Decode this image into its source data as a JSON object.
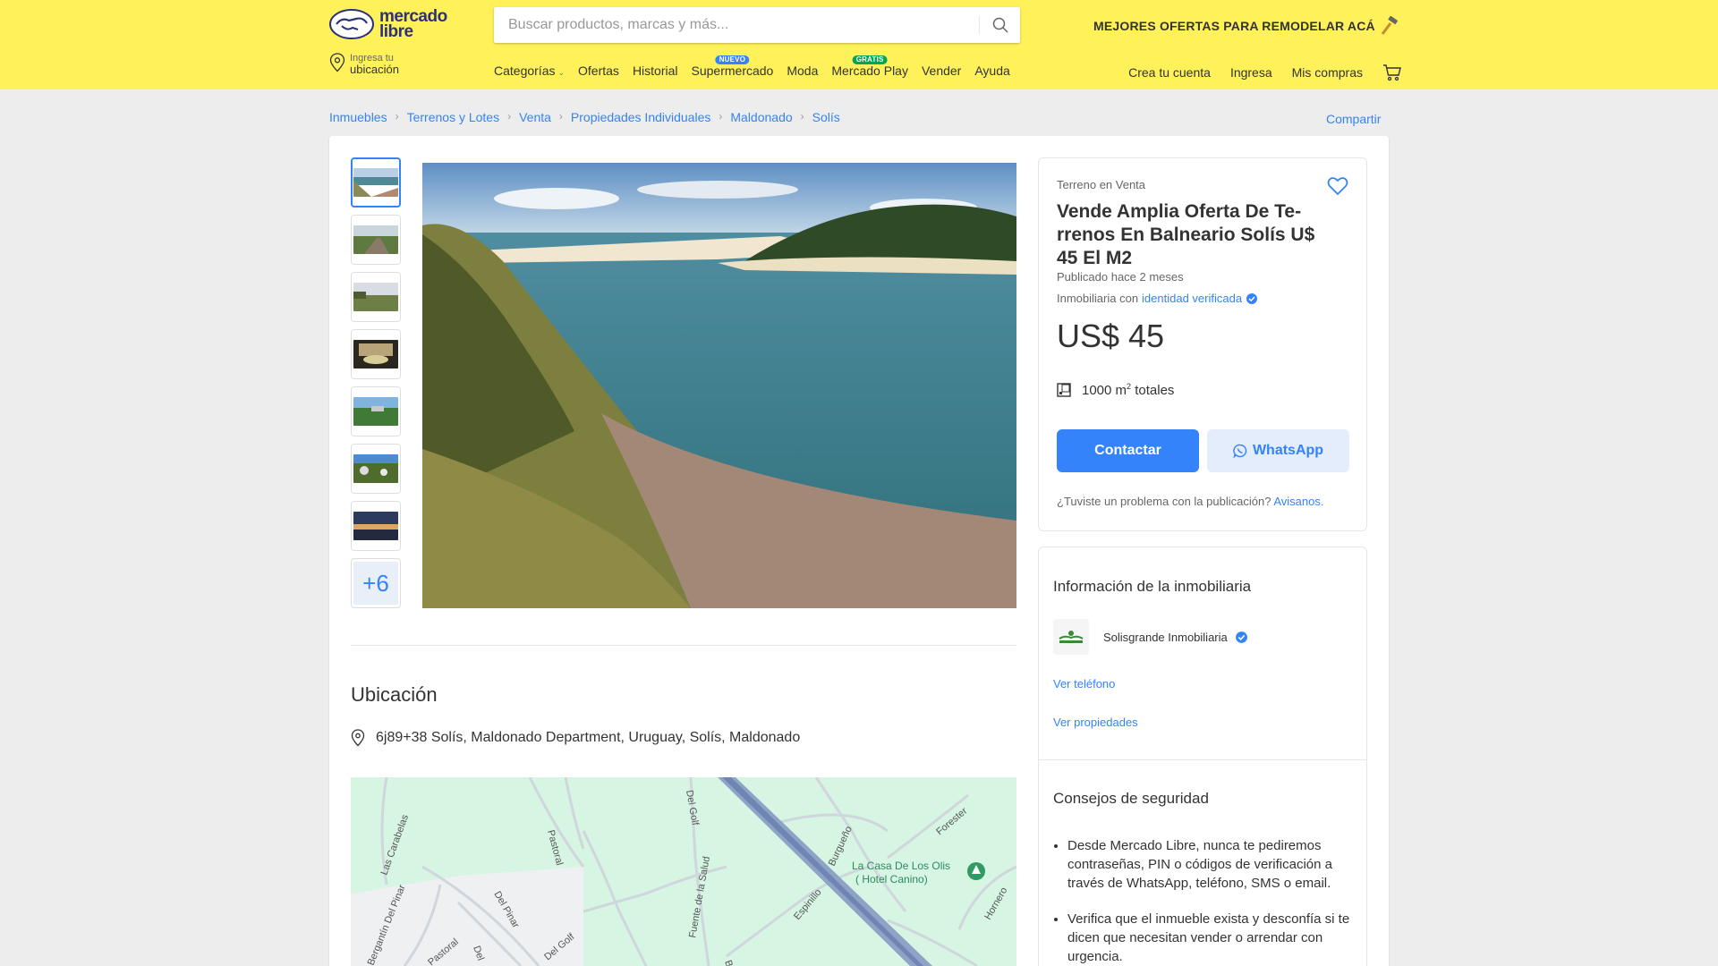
{
  "header": {
    "logo_line1": "mercado",
    "logo_line2": "libre",
    "search_placeholder": "Buscar productos, marcas y más...",
    "promo": "MEJORES OFERTAS PARA REMODELAR ACÁ",
    "location_small": "Ingresa tu",
    "location_big": "ubicación",
    "nav": [
      {
        "label": "Categorías",
        "badge": ""
      },
      {
        "label": "Ofertas",
        "badge": ""
      },
      {
        "label": "Historial",
        "badge": ""
      },
      {
        "label": "Supermercado",
        "badge": "NUEVO"
      },
      {
        "label": "Moda",
        "badge": ""
      },
      {
        "label": "Mercado Play",
        "badge": "GRATIS"
      },
      {
        "label": "Vender",
        "badge": ""
      },
      {
        "label": "Ayuda",
        "badge": ""
      }
    ],
    "account": [
      "Crea tu cuenta",
      "Ingresa",
      "Mis compras"
    ],
    "colors": {
      "brand_yellow": "#fff159",
      "brand_blue": "#2d3277",
      "accent": "#3483fa",
      "badge_green": "#00a650"
    }
  },
  "breadcrumb": [
    "Inmuebles",
    "Terrenos y Lotes",
    "Venta",
    "Propiedades Individuales",
    "Maldonado",
    "Solís"
  ],
  "share": "Compartir",
  "gallery": {
    "thumbnails": [
      "beach-lagoon",
      "dirt-road",
      "field",
      "terrace-table",
      "hill-view",
      "garden-plants",
      "sunset"
    ],
    "more": "+6"
  },
  "location": {
    "title": "Ubicación",
    "address": "6j89+38 Solís, Maldonado Department, Uruguay, Solís, Maldonado",
    "map_labels": {
      "road1": "Las Carabelas",
      "road2": "Del Pinar",
      "road3": "Bergantín Del Pinar",
      "road4": "Pastoral",
      "road5": "Del Golf",
      "road6": "Fuente de la Salud",
      "road7": "Espinillo",
      "road8": "Burgueño",
      "road9": "Forester",
      "road10": "Hornero",
      "road11": "Del Golf",
      "road12": "Pastoral",
      "road13": "Del",
      "road14": "Be",
      "road15": "Del Golf",
      "place_line1": "La Casa De Los Olis",
      "place_line2": "( Hotel Canino)"
    }
  },
  "listing": {
    "condition": "Terreno en Venta",
    "title": "Vende Amplia Oferta De Te-rrenos En Balneario Solís U$ 45 El M2",
    "published": "Publicado hace 2 meses",
    "verified_prefix": "Inmobiliaria con",
    "verified_link": "identidad verificada",
    "price": "US$ 45",
    "area_value": "1000 m",
    "area_sup": "2",
    "area_suffix": "totales",
    "contact_button": "Contactar",
    "whatsapp_button": "WhatsApp",
    "problem_text": "¿Tuviste un problema con la publicación?",
    "problem_link": "Avisanos."
  },
  "seller": {
    "section_title": "Información de la inmobiliaria",
    "name": "Solisgrande Inmobiliaria",
    "phone_link": "Ver teléfono",
    "properties_link": "Ver propiedades"
  },
  "safety": {
    "title": "Consejos de seguridad",
    "tips": [
      "Desde Mercado Libre, nunca te pediremos contraseñas, PIN o códigos de verificación a través de WhatsApp, teléfono, SMS o email.",
      "Verifica que el inmueble exista y desconfía si te dicen que necesitan vender o arrendar con urgencia."
    ]
  }
}
